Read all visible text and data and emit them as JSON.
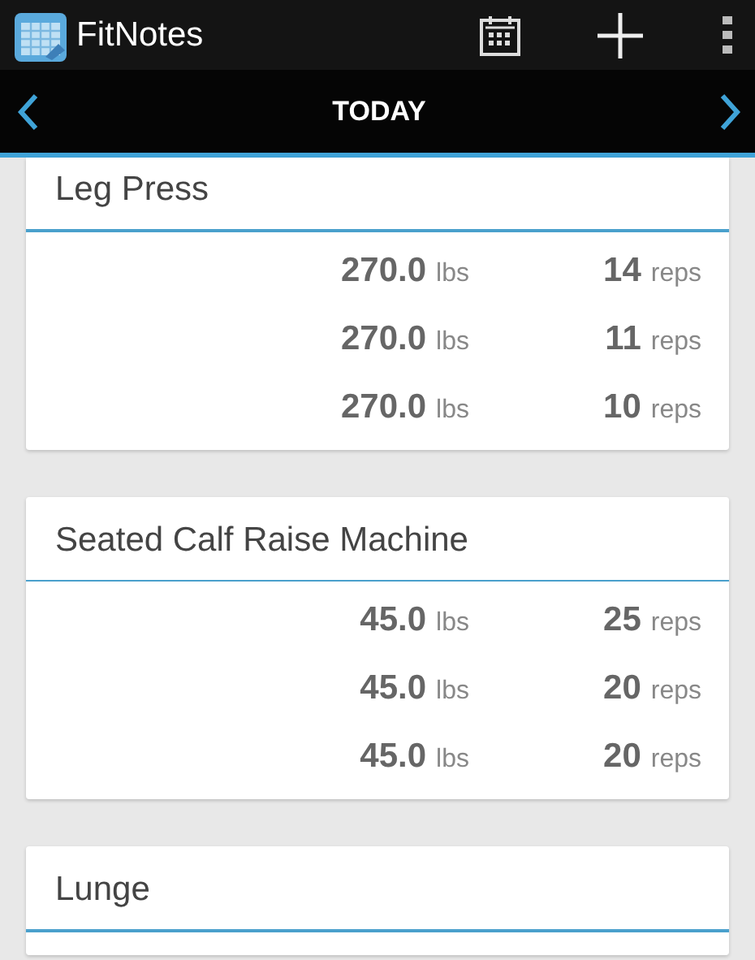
{
  "app_bar": {
    "title": "FitNotes"
  },
  "date_bar": {
    "label": "TODAY"
  },
  "exercises": [
    {
      "name": "Leg Press",
      "sets": [
        {
          "weight": "270.0",
          "weight_unit": "lbs",
          "reps": "14",
          "reps_unit": "reps"
        },
        {
          "weight": "270.0",
          "weight_unit": "lbs",
          "reps": "11",
          "reps_unit": "reps"
        },
        {
          "weight": "270.0",
          "weight_unit": "lbs",
          "reps": "10",
          "reps_unit": "reps"
        }
      ]
    },
    {
      "name": "Seated Calf Raise Machine",
      "sets": [
        {
          "weight": "45.0",
          "weight_unit": "lbs",
          "reps": "25",
          "reps_unit": "reps"
        },
        {
          "weight": "45.0",
          "weight_unit": "lbs",
          "reps": "20",
          "reps_unit": "reps"
        },
        {
          "weight": "45.0",
          "weight_unit": "lbs",
          "reps": "20",
          "reps_unit": "reps"
        }
      ]
    },
    {
      "name": "Lunge"
    }
  ]
}
